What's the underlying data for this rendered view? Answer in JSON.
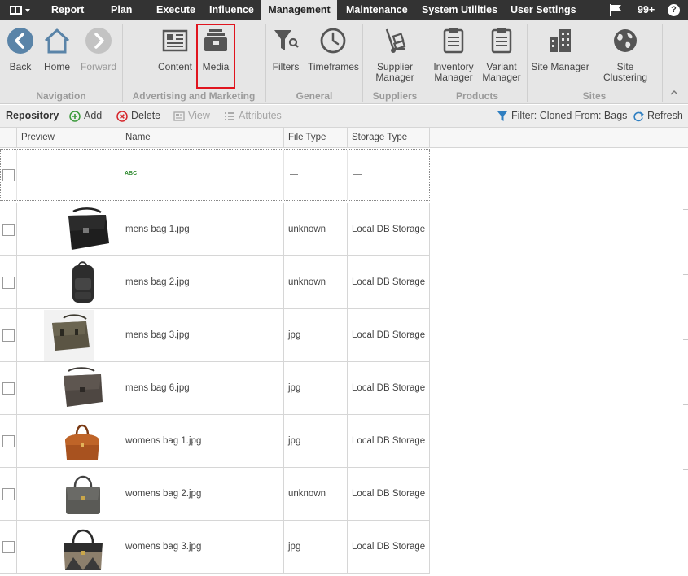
{
  "topbar": {
    "app_menu_icon": "grid-menu-icon",
    "menu": [
      "Report",
      "Plan",
      "Execute",
      "Influence",
      "Management",
      "Maintenance",
      "System Utilities",
      "User Settings"
    ],
    "active": "Management",
    "notifications_count": "99+",
    "flag_icon": "flag-icon",
    "help_icon": "help-icon",
    "help_glyph": "?"
  },
  "ribbon": {
    "groups": [
      {
        "label": "Navigation",
        "buttons": [
          {
            "label": "Back",
            "icon": "back-arrow-icon"
          },
          {
            "label": "Home",
            "icon": "home-icon"
          },
          {
            "label": "Forward",
            "icon": "forward-arrow-icon",
            "disabled": true
          }
        ]
      },
      {
        "label": "Advertising and Marketing",
        "buttons": [
          {
            "label": "Content",
            "icon": "newspaper-icon"
          },
          {
            "label": "Media",
            "icon": "media-drawer-icon",
            "highlighted": true
          }
        ]
      },
      {
        "label": "General",
        "buttons": [
          {
            "label": "Filters",
            "icon": "funnel-icon"
          },
          {
            "label": "Timeframes",
            "icon": "clock-icon"
          }
        ]
      },
      {
        "label": "Suppliers",
        "buttons": [
          {
            "label": "Supplier Manager",
            "line1": "Supplier",
            "line2": "Manager",
            "icon": "hand-truck-icon"
          }
        ]
      },
      {
        "label": "Products",
        "buttons": [
          {
            "label": "Inventory Manager",
            "line1": "Inventory",
            "line2": "Manager",
            "icon": "clipboard-list-icon"
          },
          {
            "label": "Variant Manager",
            "line1": "Variant",
            "line2": "Manager",
            "icon": "clipboard-list-icon"
          }
        ]
      },
      {
        "label": "Sites",
        "buttons": [
          {
            "label": "Site Manager",
            "icon": "buildings-icon"
          },
          {
            "label": "Site Clustering",
            "icon": "globe-icon"
          }
        ]
      }
    ]
  },
  "toolbar": {
    "title": "Repository",
    "add": "Add",
    "delete": "Delete",
    "view": "View",
    "attributes": "Attributes",
    "filter": "Filter: Cloned From: Bags",
    "refresh": "Refresh"
  },
  "grid": {
    "columns": [
      "Preview",
      "Name",
      "File Type",
      "Storage Type"
    ],
    "filter_row": {
      "name_icon": "text-filter-icon",
      "name_glyph": "ABC",
      "equals_icon": "equals-filter-icon"
    },
    "rows": [
      {
        "preview": "black leather messenger bag",
        "name": "mens bag 1.jpg",
        "file_type": "unknown",
        "storage": "Local DB Storage"
      },
      {
        "preview": "black leather backpack",
        "name": "mens bag 2.jpg",
        "file_type": "unknown",
        "storage": "Local DB Storage"
      },
      {
        "preview": "olive canvas messenger bag",
        "name": "mens bag 3.jpg",
        "file_type": "jpg",
        "storage": "Local DB Storage"
      },
      {
        "preview": "brown messenger bag",
        "name": "mens bag 6.jpg",
        "file_type": "jpg",
        "storage": "Local DB Storage"
      },
      {
        "preview": "tan leather handbag",
        "name": "womens bag 1.jpg",
        "file_type": "jpg",
        "storage": "Local DB Storage"
      },
      {
        "preview": "grey leather handbag",
        "name": "womens bag 2.jpg",
        "file_type": "unknown",
        "storage": "Local DB Storage"
      },
      {
        "preview": "taupe tote handbag",
        "name": "womens bag 3.jpg",
        "file_type": "jpg",
        "storage": "Local DB Storage"
      }
    ]
  },
  "colors": {
    "topbar": "#333333",
    "ribbon": "#e6e6e6",
    "highlight": "#e0141e",
    "add_green": "#3c9a3c",
    "delete_red": "#d6262c",
    "link_blue": "#2f7fc1"
  }
}
